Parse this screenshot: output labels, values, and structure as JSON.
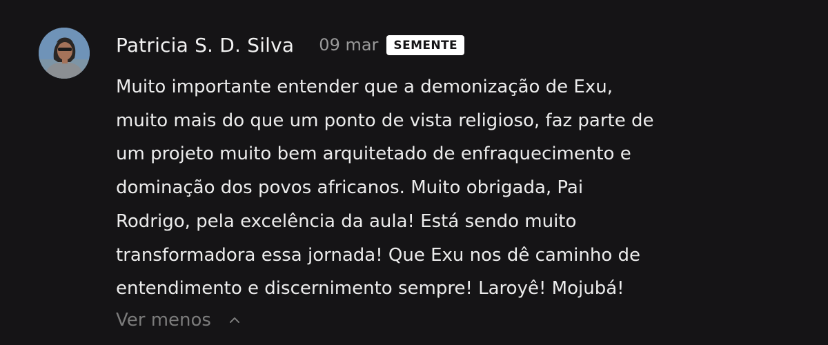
{
  "comment": {
    "author": "Patricia S. D. Silva",
    "date": "09 mar",
    "badge": "SEMENTE",
    "lines": [
      "Muito importante entender que a demonização de Exu,",
      "muito mais do que um ponto de vista religioso, faz parte de",
      "um projeto muito bem arquitetado de enfraquecimento e",
      "dominação dos povos africanos. Muito obrigada, Pai",
      "Rodrigo, pela excelência da aula! Está sendo muito",
      "transformadora essa jornada! Que Exu nos dê caminho de",
      "entendimento e discernimento sempre! Laroyê! Mojubá!"
    ],
    "toggle_label": "Ver menos",
    "toggle_icon": "chevron-up-icon"
  },
  "colors": {
    "background": "#151416",
    "text": "#ececec",
    "muted": "#9a9a9a",
    "badge_bg": "#ffffff",
    "badge_text": "#151416"
  }
}
